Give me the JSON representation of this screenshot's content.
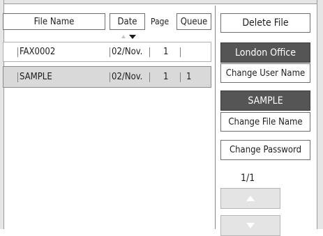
{
  "columns": {
    "file_name": "File Name",
    "date": "Date",
    "page": "Page",
    "queue": "Queue"
  },
  "files": [
    {
      "name": "FAX0002",
      "date": "02/Nov.",
      "page": "1",
      "queue": ""
    },
    {
      "name": "SAMPLE",
      "date": "02/Nov.",
      "page": "1",
      "queue": "1"
    }
  ],
  "side_panel": {
    "delete_file": "Delete File",
    "user_name": "London Office",
    "change_user_name": "Change User Name",
    "file_name": "SAMPLE",
    "change_file_name": "Change File Name",
    "change_password": "Change Password",
    "page_counter": "1/1"
  },
  "icons": {
    "sort": "triangle-up-down",
    "scroll_up": "triangle-up",
    "scroll_down": "triangle-down"
  },
  "colors": {
    "dark_button": "#555555",
    "selected_row": "#d9d9d9"
  }
}
